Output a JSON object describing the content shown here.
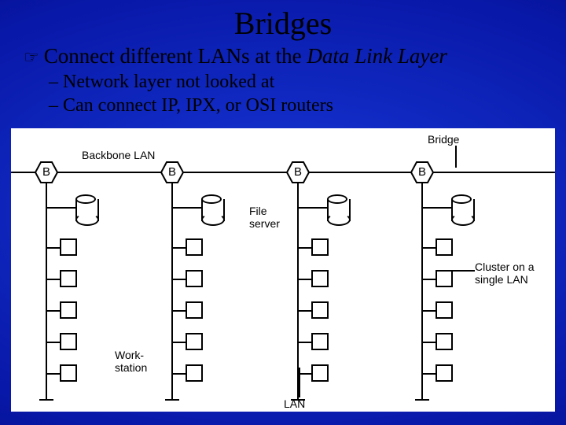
{
  "title": "Bridges",
  "bullet_icon": "☞",
  "main_line_plain": "Connect different LANs at the ",
  "main_line_italic": "Data Link Layer",
  "sub1": "– Network layer not looked at",
  "sub2": "– Can connect IP, IPX, or OSI routers",
  "diagram": {
    "backbone_label": "Backbone LAN",
    "bridge_label": "Bridge",
    "file_server_label": "File\nserver",
    "workstation_label": "Work-\nstation",
    "cluster_label": "Cluster on a\nsingle LAN",
    "lan_label": "LAN",
    "bridge_letter": "B"
  }
}
